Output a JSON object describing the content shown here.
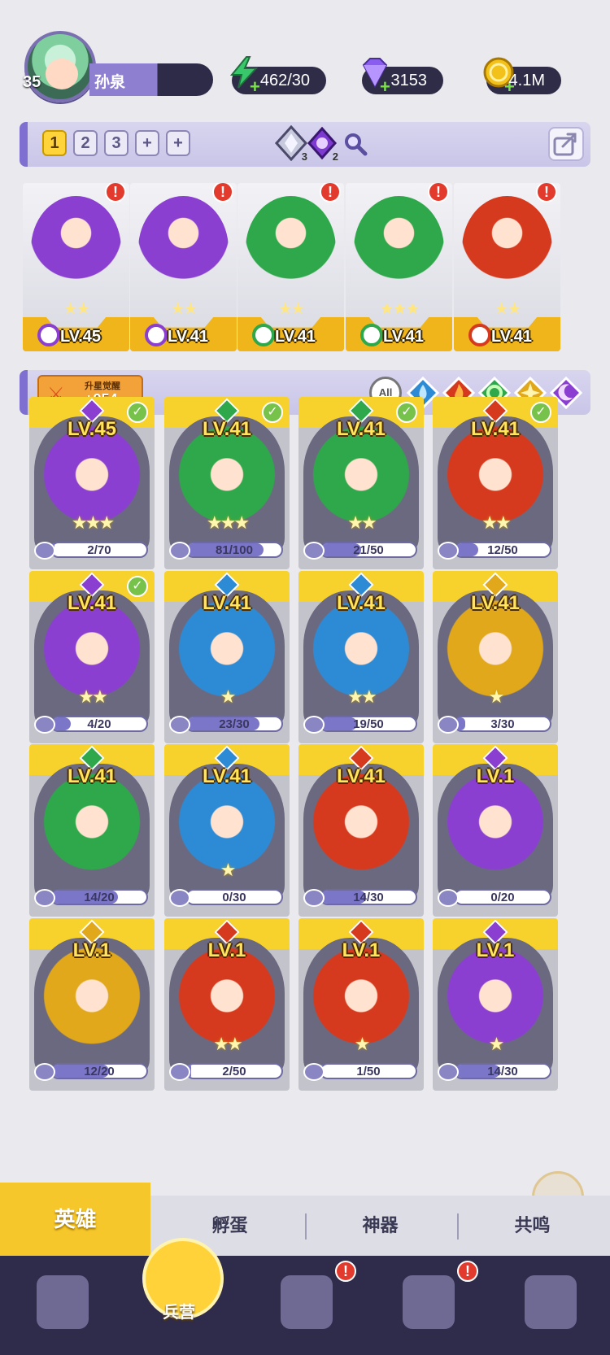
{
  "player": {
    "level": "35",
    "name": "孙泉"
  },
  "resources": [
    {
      "name": "energy",
      "value": "462/30",
      "icon": "lightning-icon",
      "color": "#38c76a"
    },
    {
      "name": "gems",
      "value": "3153",
      "icon": "gem-icon",
      "color": "#8a5cf0"
    },
    {
      "name": "gold",
      "value": "4.1M",
      "icon": "coin-icon",
      "color": "#f3c21a"
    }
  ],
  "team_tabs": [
    "1",
    "2",
    "3",
    "+",
    "+"
  ],
  "active_team": "1",
  "crystals": [
    {
      "count": "3",
      "icon": "silver-crystal-icon"
    },
    {
      "count": "2",
      "icon": "purple-crystal-icon"
    }
  ],
  "team_slots": [
    {
      "level": "LV.45",
      "stars": "★★",
      "element": "dark",
      "alert": "!"
    },
    {
      "level": "LV.41",
      "stars": "★★",
      "element": "dark",
      "alert": "!"
    },
    {
      "level": "LV.41",
      "stars": "★★",
      "element": "nature",
      "alert": "!"
    },
    {
      "level": "LV.41",
      "stars": "★★★",
      "element": "nature",
      "alert": "!"
    },
    {
      "level": "LV.41",
      "stars": "★★",
      "element": "fire",
      "alert": "!"
    }
  ],
  "awaken": {
    "title": "升星觉醒",
    "value": "+954"
  },
  "filters": [
    {
      "label": "All",
      "icon": "all-filter-icon"
    },
    {
      "icon": "water-element-icon",
      "color": "#2d8bd6"
    },
    {
      "icon": "fire-element-icon",
      "color": "#d63a1e"
    },
    {
      "icon": "nature-element-icon",
      "color": "#2fa84b"
    },
    {
      "icon": "light-element-icon",
      "color": "#e0a81a"
    },
    {
      "icon": "dark-element-icon",
      "color": "#8a3fd0"
    }
  ],
  "heroes": [
    {
      "level": "LV.45",
      "element": "dark",
      "stars": "★★★",
      "progress": "2/70",
      "ratio": 0.03,
      "check": true
    },
    {
      "level": "LV.41",
      "element": "nature",
      "stars": "★★★",
      "progress": "81/100",
      "ratio": 0.81,
      "check": true
    },
    {
      "level": "LV.41",
      "element": "nature",
      "stars": "★★",
      "progress": "21/50",
      "ratio": 0.42,
      "check": true
    },
    {
      "level": "LV.41",
      "element": "fire",
      "stars": "★★",
      "progress": "12/50",
      "ratio": 0.24,
      "check": true
    },
    {
      "level": "LV.41",
      "element": "dark",
      "stars": "★★",
      "progress": "4/20",
      "ratio": 0.2,
      "check": true
    },
    {
      "level": "LV.41",
      "element": "water",
      "stars": "★",
      "progress": "23/30",
      "ratio": 0.77,
      "check": false
    },
    {
      "level": "LV.41",
      "element": "water",
      "stars": "★★",
      "progress": "19/50",
      "ratio": 0.38,
      "check": false
    },
    {
      "level": "LV.41",
      "element": "light",
      "stars": "★",
      "progress": "3/30",
      "ratio": 0.1,
      "check": false
    },
    {
      "level": "LV.41",
      "element": "nature",
      "stars": "",
      "progress": "14/20",
      "ratio": 0.7,
      "check": false
    },
    {
      "level": "LV.41",
      "element": "water",
      "stars": "★",
      "progress": "0/30",
      "ratio": 0,
      "check": false
    },
    {
      "level": "LV.41",
      "element": "fire",
      "stars": "",
      "progress": "14/30",
      "ratio": 0.47,
      "check": false
    },
    {
      "level": "LV.1",
      "element": "dark",
      "stars": "",
      "progress": "0/20",
      "ratio": 0,
      "check": false
    },
    {
      "level": "LV.1",
      "element": "light",
      "stars": "",
      "progress": "12/20",
      "ratio": 0.6,
      "check": false
    },
    {
      "level": "LV.1",
      "element": "fire",
      "stars": "★★",
      "progress": "2/50",
      "ratio": 0.04,
      "check": false
    },
    {
      "level": "LV.1",
      "element": "fire",
      "stars": "★",
      "progress": "1/50",
      "ratio": 0.02,
      "check": false
    },
    {
      "level": "LV.1",
      "element": "dark",
      "stars": "★",
      "progress": "14/30",
      "ratio": 0.47,
      "check": false
    }
  ],
  "element_colors": {
    "dark": "#8a3fd0",
    "nature": "#2fa84b",
    "fire": "#d63a1e",
    "water": "#2d8bd6",
    "light": "#e0a81a"
  },
  "sub_tabs": [
    "英雄",
    "孵蛋",
    "神器",
    "共鸣"
  ],
  "active_sub_tab": "英雄",
  "bottom_nav": [
    {
      "icon": "cards-icon",
      "label": ""
    },
    {
      "icon": "barracks-fist-icon",
      "label": "兵营",
      "active": true
    },
    {
      "icon": "map-book-icon",
      "label": "",
      "alert": "!"
    },
    {
      "icon": "shrine-icon",
      "label": "",
      "alert": "!"
    },
    {
      "icon": "mushroom-guild-icon",
      "label": ""
    }
  ]
}
